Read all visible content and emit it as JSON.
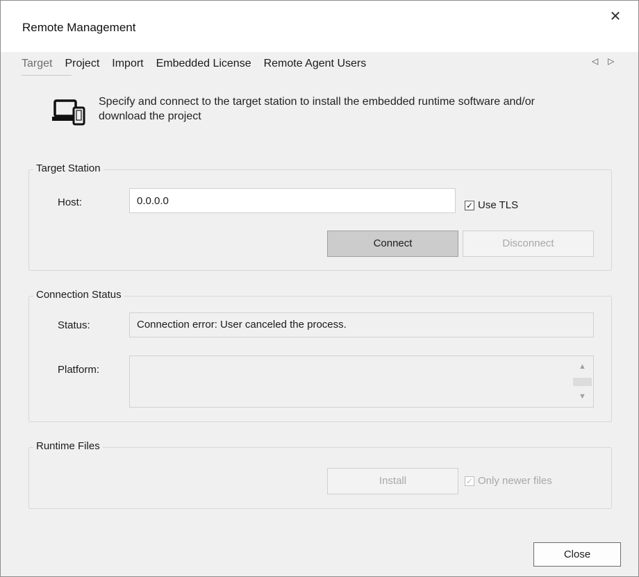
{
  "window": {
    "title": "Remote Management",
    "close_symbol": "✕"
  },
  "tabs": [
    {
      "label": "Target",
      "active": true
    },
    {
      "label": "Project",
      "active": false
    },
    {
      "label": "Import",
      "active": false
    },
    {
      "label": "Embedded License",
      "active": false
    },
    {
      "label": "Remote Agent Users",
      "active": false
    }
  ],
  "tab_nav": {
    "prev_icon": "◁",
    "next_icon": "▷"
  },
  "intro": {
    "icon": "devices-icon",
    "text": "Specify and connect to the target station to install the embedded runtime software and/or download the project"
  },
  "target_station": {
    "legend": "Target Station",
    "host_label": "Host:",
    "host_value": "0.0.0.0",
    "use_tls_label": "Use TLS",
    "use_tls_checked": true,
    "connect_label": "Connect",
    "disconnect_label": "Disconnect"
  },
  "connection_status": {
    "legend": "Connection Status",
    "status_label": "Status:",
    "status_value": "Connection error: User canceled the process.",
    "platform_label": "Platform:",
    "platform_value": "",
    "scroll_up_icon": "▲",
    "scroll_down_icon": "▼"
  },
  "runtime_files": {
    "legend": "Runtime Files",
    "install_label": "Install",
    "only_newer_label": "Only newer files",
    "only_newer_checked": true
  },
  "footer": {
    "close_label": "Close"
  },
  "colors": {
    "dialog_bg": "#f0f0f0",
    "titlebar_bg": "#ffffff",
    "group_border": "#d7d7d7",
    "disabled_text": "#a8a8a8"
  }
}
